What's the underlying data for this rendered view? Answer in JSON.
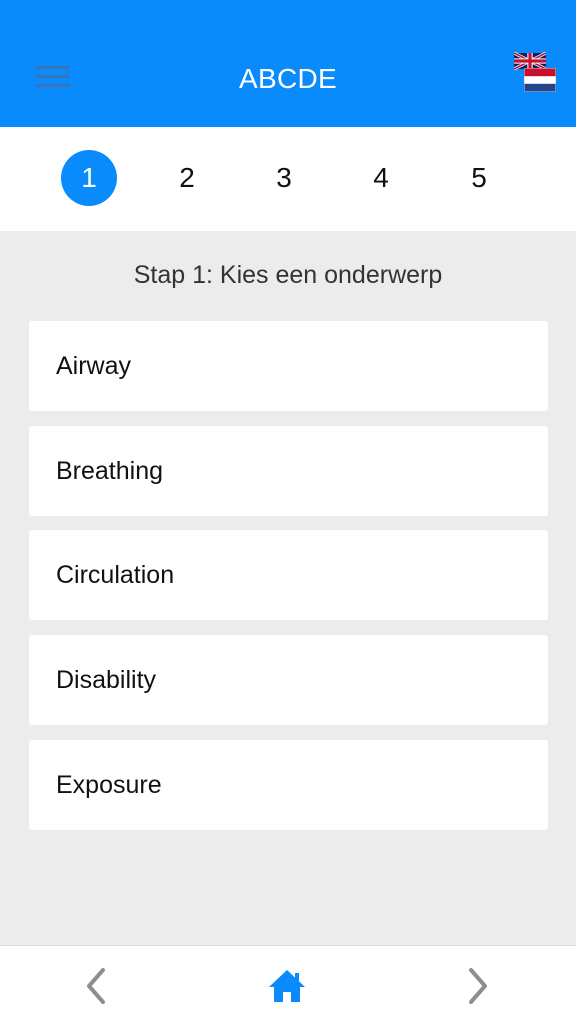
{
  "header": {
    "title": "ABCDE",
    "menu_icon": "hamburger-menu-icon",
    "language_icons": [
      "flag-uk-icon",
      "flag-nl-icon"
    ],
    "color": "#0a8bfb"
  },
  "steps": {
    "items": [
      "1",
      "2",
      "3",
      "4",
      "5"
    ],
    "active": "1"
  },
  "main": {
    "instruction": "Stap 1: Kies een onderwerp",
    "topics": [
      "Airway",
      "Breathing",
      "Circulation",
      "Disability",
      "Exposure"
    ]
  },
  "bottom_nav": {
    "icons": [
      "chevron-left-icon",
      "home-icon",
      "chevron-right-icon"
    ],
    "home_color": "#0a8bfb",
    "arrow_color": "#8e8e8e"
  }
}
